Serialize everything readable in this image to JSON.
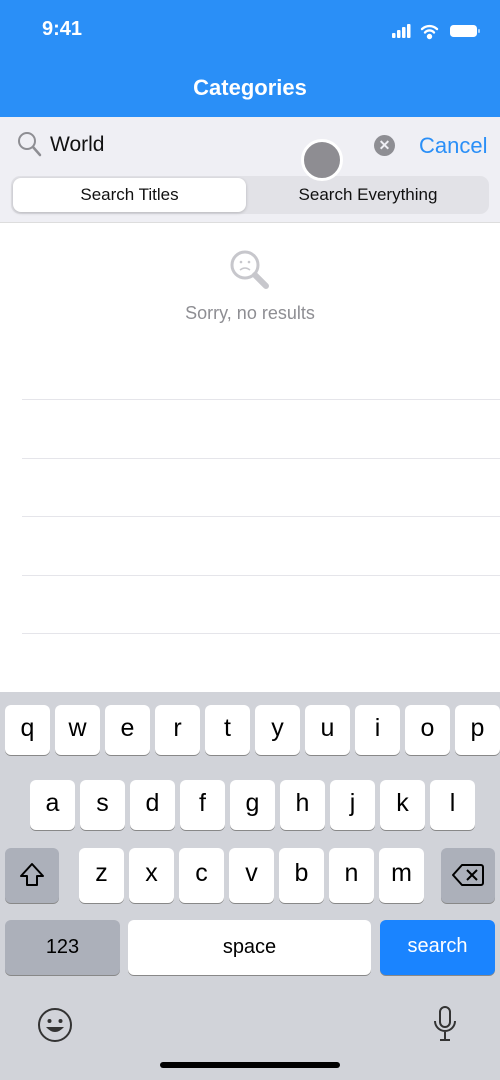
{
  "status_bar": {
    "time": "9:41",
    "icons": [
      "cellular-signal-icon",
      "wifi-icon",
      "battery-icon"
    ]
  },
  "nav": {
    "title": "Categories"
  },
  "search": {
    "query": "World",
    "cancel_label": "Cancel",
    "clear_icon": "clear-icon",
    "search_icon": "search-icon"
  },
  "segments": [
    {
      "label": "Search Titles",
      "selected": true
    },
    {
      "label": "Search Everything",
      "selected": false
    }
  ],
  "empty_state": {
    "icon": "sad-magnifier-icon",
    "message": "Sorry, no results"
  },
  "keyboard": {
    "rows": [
      [
        "q",
        "w",
        "e",
        "r",
        "t",
        "y",
        "u",
        "i",
        "o",
        "p"
      ],
      [
        "a",
        "s",
        "d",
        "f",
        "g",
        "h",
        "j",
        "k",
        "l"
      ],
      [
        "z",
        "x",
        "c",
        "v",
        "b",
        "n",
        "m"
      ]
    ],
    "numbers_label": "123",
    "space_label": "space",
    "search_label": "search",
    "accent": "#1a84ff"
  },
  "colors": {
    "nav": "#2a8ff7",
    "accent": "#2a8ff7"
  }
}
